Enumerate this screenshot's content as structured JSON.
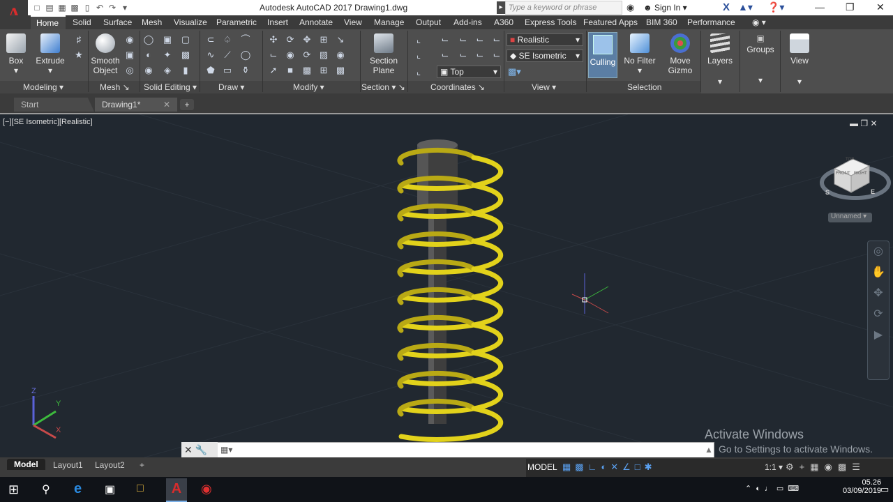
{
  "titlebar": {
    "title": "Autodesk AutoCAD 2017    Drawing1.dwg",
    "search_placeholder": "Type a keyword or phrase",
    "sign_in": "Sign In",
    "app_letter": "A"
  },
  "ribbon_tabs": [
    "Home",
    "Solid",
    "Surface",
    "Mesh",
    "Visualize",
    "Parametric",
    "Insert",
    "Annotate",
    "View",
    "Manage",
    "Output",
    "Add-ins",
    "A360",
    "Express Tools",
    "Featured Apps",
    "BIM 360",
    "Performance"
  ],
  "ribbon": {
    "box": "Box",
    "extrude": "Extrude",
    "smooth_object_1": "Smooth",
    "smooth_object_2": "Object",
    "section_plane_1": "Section",
    "section_plane_2": "Plane",
    "culling": "Culling",
    "no_filter": "No Filter",
    "move_gizmo_1": "Move",
    "move_gizmo_2": "Gizmo",
    "layers": "Layers",
    "groups": "Groups",
    "view": "View",
    "visual_style": "Realistic",
    "view_preset": "SE Isometric",
    "ucs_preset": "Top"
  },
  "panels": [
    "Modeling",
    "Mesh",
    "Solid Editing",
    "Draw",
    "Modify",
    "Section",
    "Coordinates",
    "View",
    "Selection"
  ],
  "doc_tabs": {
    "start": "Start",
    "drawing": "Drawing1*"
  },
  "viewport": {
    "label": "[−][SE Isometric][Realistic]",
    "unnamed": "Unnamed",
    "viewcube_top": "TOP",
    "viewcube_front": "FRONT",
    "viewcube_right": "RIGHT",
    "compass_s": "S",
    "compass_e": "E",
    "ucs_x": "X",
    "ucs_y": "Y",
    "ucs_z": "Z"
  },
  "watermark": {
    "line1": "Activate Windows",
    "line2": "Go to Settings to activate Windows."
  },
  "layout_tabs": [
    "Model",
    "Layout1",
    "Layout2"
  ],
  "status": {
    "model": "MODEL",
    "scale": "1:1"
  },
  "clock": {
    "time": "05.26",
    "date": "03/09/2019"
  },
  "colors": {
    "spring": "#e2d21b",
    "rod": "#4a4a4a",
    "accent": "#5b7ea4"
  }
}
